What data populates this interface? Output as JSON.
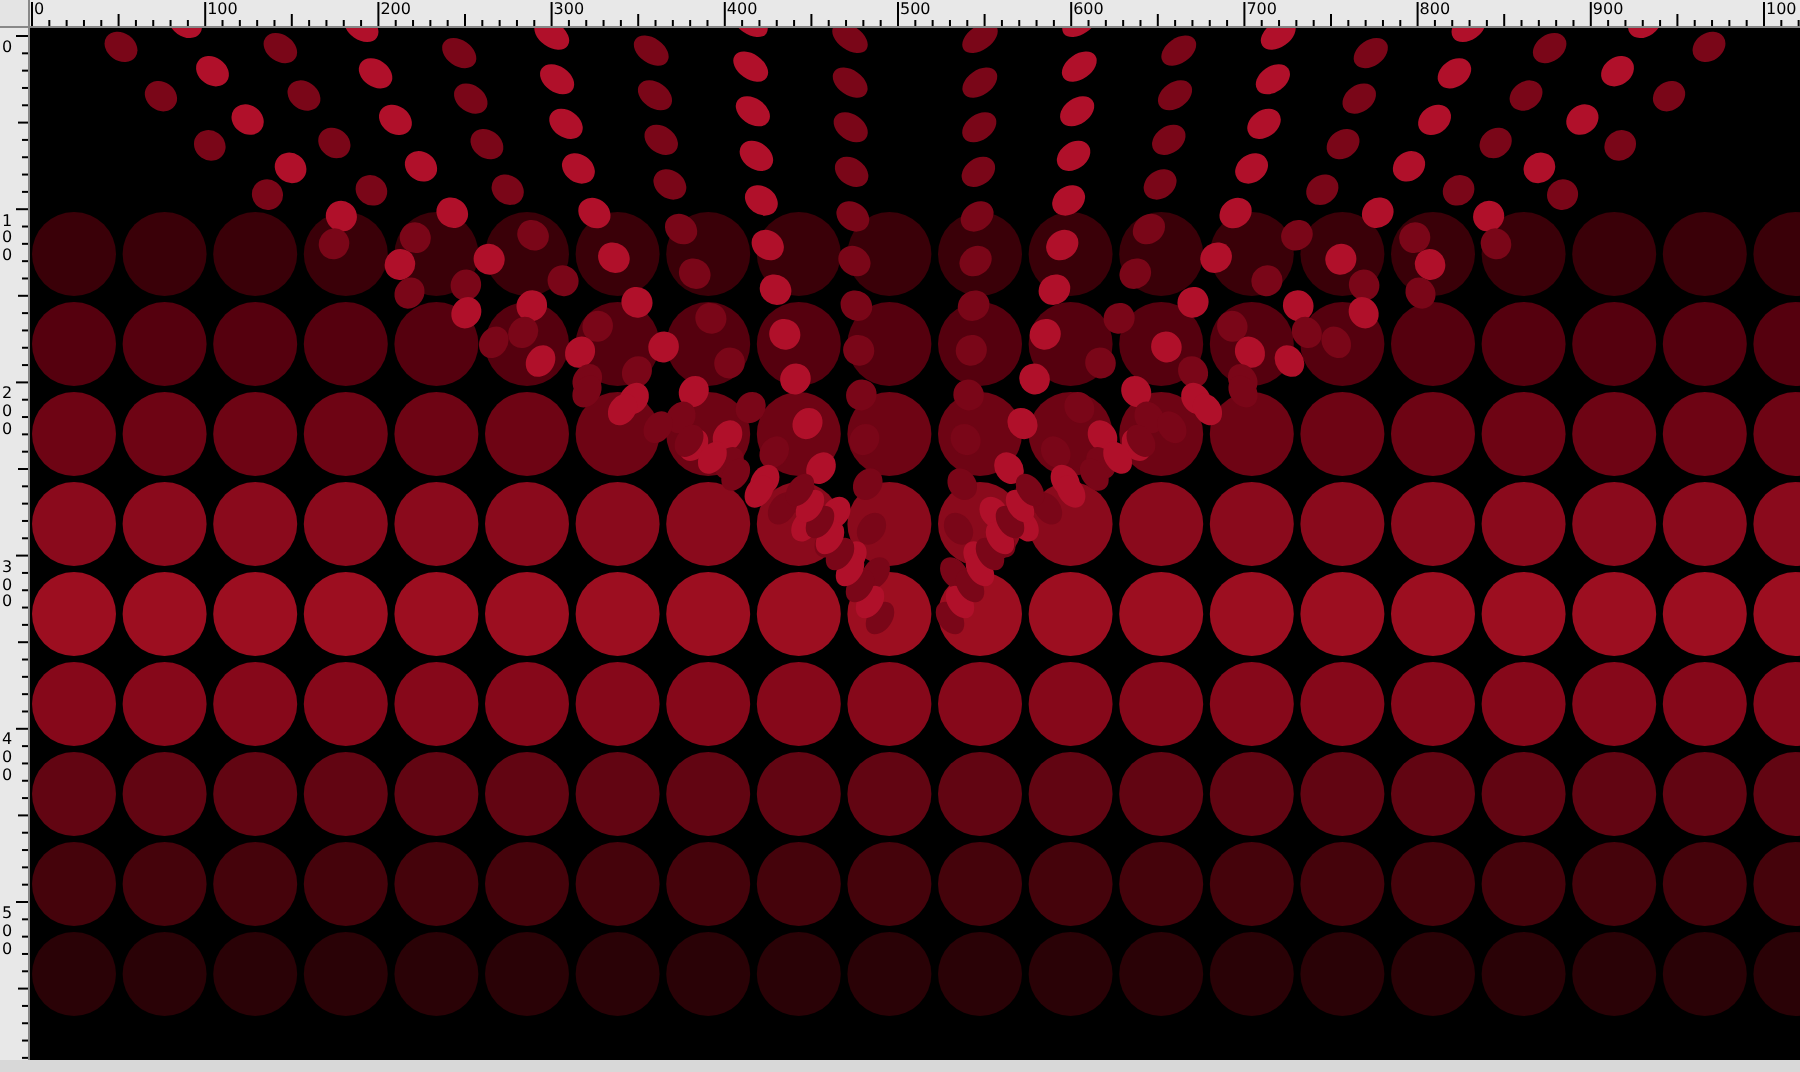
{
  "rulers": {
    "horizontal": [
      "0",
      "100",
      "200",
      "300",
      "400",
      "500",
      "600",
      "700",
      "800",
      "900",
      "100"
    ],
    "vertical": [
      "0",
      "100",
      "200",
      "300",
      "400",
      "500"
    ]
  }
}
